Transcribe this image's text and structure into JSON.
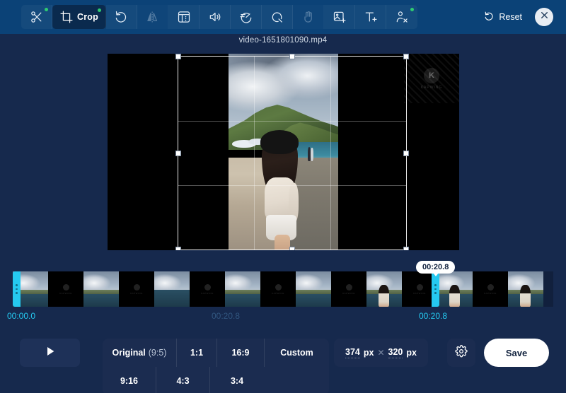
{
  "window": {
    "filename": "video-1651801090.mp4",
    "background_color": "#16294d",
    "topbar_color": "#0b4277",
    "accent_color": "#25c9f0"
  },
  "toolbar": {
    "tools": [
      {
        "id": "cut",
        "icon": "scissors-icon",
        "label": "",
        "pro": true,
        "active": false,
        "disabled": false
      },
      {
        "id": "crop",
        "icon": "crop-icon",
        "label": "Crop",
        "pro": true,
        "active": true,
        "disabled": false
      },
      {
        "id": "rotate",
        "icon": "rotate-left-icon",
        "label": "",
        "pro": false,
        "active": false,
        "disabled": false
      },
      {
        "id": "flip",
        "icon": "flip-horizontal-icon",
        "label": "",
        "pro": false,
        "active": false,
        "disabled": true
      },
      {
        "id": "adjust",
        "icon": "adjust-panel-icon",
        "label": "",
        "pro": false,
        "active": false,
        "disabled": false
      },
      {
        "id": "volume",
        "icon": "speaker-icon",
        "label": "",
        "pro": false,
        "active": false,
        "disabled": false
      },
      {
        "id": "speed",
        "icon": "speed-gauge-icon",
        "label": "",
        "pro": false,
        "active": false,
        "disabled": false
      },
      {
        "id": "loop",
        "icon": "loop-icon",
        "label": "",
        "pro": false,
        "active": false,
        "disabled": false
      },
      {
        "id": "stabilize",
        "icon": "hand-wave-icon",
        "label": "",
        "pro": false,
        "active": false,
        "disabled": true
      },
      {
        "id": "addimage",
        "icon": "image-add-icon",
        "label": "",
        "pro": false,
        "active": false,
        "disabled": false
      },
      {
        "id": "addtext",
        "icon": "text-add-icon",
        "label": "",
        "pro": false,
        "active": false,
        "disabled": false
      },
      {
        "id": "removebg",
        "icon": "person-remove-icon",
        "label": "",
        "pro": true,
        "active": false,
        "disabled": false
      }
    ],
    "reset_label": "Reset",
    "reset_icon": "reset-rotate-icon",
    "close_icon": "close-icon"
  },
  "preview": {
    "watermark_text": "KAPWING",
    "watermark_initial": "K"
  },
  "timeline": {
    "start_time": "00:00.0",
    "mid_time": "00:20.8",
    "end_time": "00:20.8",
    "tooltip_time": "00:20.8"
  },
  "bottom": {
    "play_icon": "play-icon",
    "ratios": [
      {
        "id": "original",
        "label": "Original",
        "sub": "(9:5)"
      },
      {
        "id": "1to1",
        "label": "1:1",
        "sub": ""
      },
      {
        "id": "16to9",
        "label": "16:9",
        "sub": ""
      },
      {
        "id": "custom",
        "label": "Custom",
        "sub": ""
      },
      {
        "id": "9to16",
        "label": "9:16",
        "sub": ""
      },
      {
        "id": "4to3",
        "label": "4:3",
        "sub": ""
      },
      {
        "id": "3to4",
        "label": "3:4",
        "sub": ""
      }
    ],
    "size": {
      "width": "374",
      "width_unit": "px",
      "separator": "✕",
      "height": "320",
      "height_unit": "px"
    },
    "gear_icon": "gear-icon",
    "save_label": "Save"
  }
}
